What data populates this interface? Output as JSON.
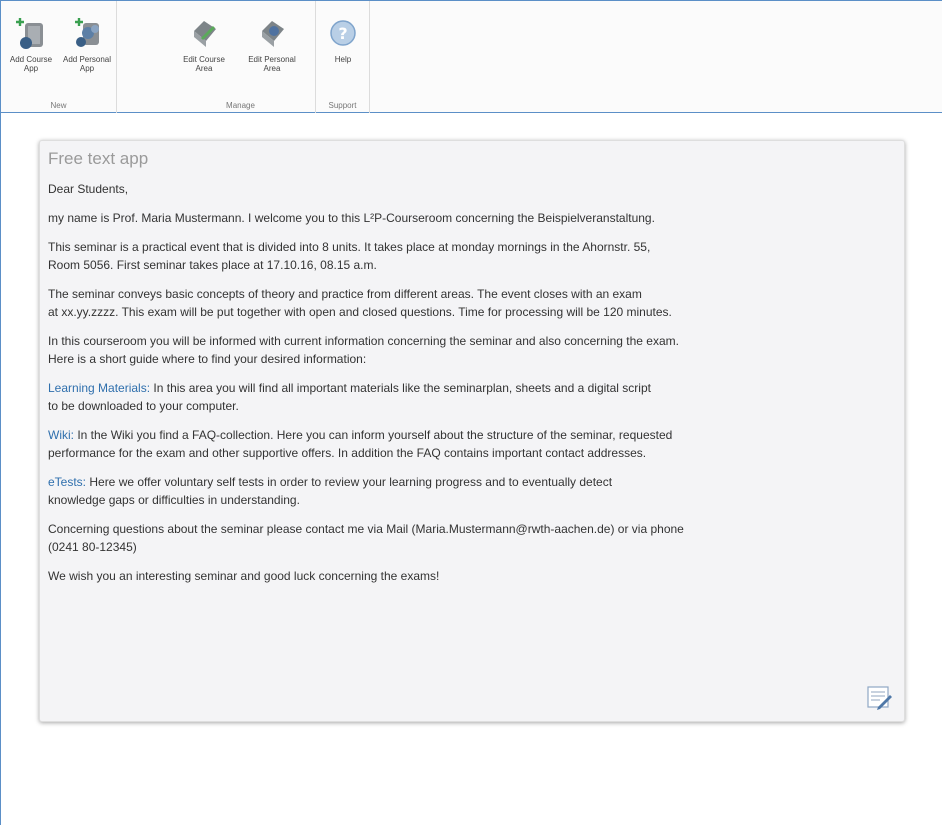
{
  "ribbon": {
    "groups": [
      {
        "label": "New",
        "buttons": [
          {
            "label": "Add Course\nApp",
            "icon": "add-course-app-icon"
          },
          {
            "label": "Add Personal\nApp",
            "icon": "add-personal-app-icon"
          }
        ]
      },
      {
        "label": "Manage",
        "buttons": [
          {
            "label": "Edit Course\nArea",
            "icon": "edit-course-area-icon"
          },
          {
            "label": "Edit Personal\nArea",
            "icon": "edit-personal-area-icon"
          }
        ]
      },
      {
        "label": "Support",
        "buttons": [
          {
            "label": "Help",
            "icon": "help-icon"
          }
        ]
      }
    ]
  },
  "app": {
    "title": "Free text app",
    "greeting": "Dear Students,",
    "p1": "my name is Prof. Maria Mustermann. I welcome you to this L²P-Courseroom concerning the Beispielveranstaltung.",
    "p2a": "This seminar is a practical event that is divided into 8 units. It takes place at monday mornings in the Ahornstr. 55,",
    "p2b": "Room 5056. First seminar takes place at 17.10.16, 08.15 a.m.",
    "p3a": "The seminar conveys basic concepts of theory and practice from different areas. The event closes with an exam",
    "p3b": "at xx.yy.zzzz. This exam will be put together with open and closed questions. Time for processing will be 120 minutes.",
    "p4a": "In this courseroom you will be informed with current information concerning the seminar and also concerning the exam.",
    "p4b": "Here is a short guide where to find your desired information:",
    "lm_link": "Learning Materials:",
    "lm_a": " In this area you will find all important materials like the seminarplan, sheets and a digital script",
    "lm_b": "to be downloaded to your computer.",
    "wiki_link": "Wiki:",
    "wiki_a": " In the Wiki you find a FAQ-collection. Here you can inform yourself about the structure of the seminar, requested",
    "wiki_b": "performance for the exam and other supportive offers. In addition the FAQ contains important contact addresses.",
    "etests_link": "eTests:",
    "etests_a": " Here we offer voluntary self tests in order to review your learning progress and to eventually detect",
    "etests_b": "knowledge gaps or difficulties in understanding.",
    "contact_a": "Concerning questions about the seminar please contact me via Mail (Maria.Mustermann@rwth-aachen.de) or via phone",
    "contact_b": "(0241 80-12345)",
    "closing": "We wish you an interesting seminar and good luck concerning the exams!"
  },
  "colors": {
    "accent_border": "#5b8fc7",
    "link": "#2f6fad",
    "panel_bg": "#f4f4f6"
  }
}
